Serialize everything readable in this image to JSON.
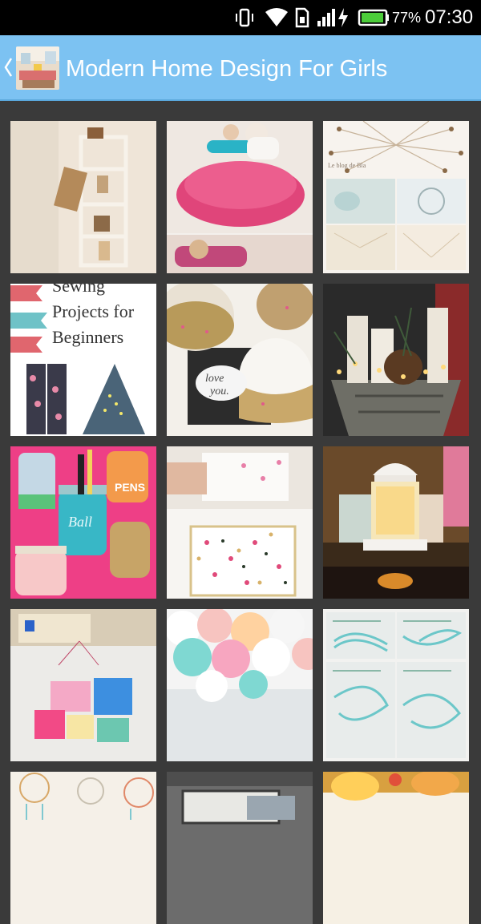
{
  "status_bar": {
    "battery_percent": "77%",
    "time": "07:30",
    "icons": [
      "vibrate-icon",
      "wifi-icon",
      "sim-icon",
      "signal-icon",
      "charging-icon",
      "battery-icon"
    ]
  },
  "app_bar": {
    "title": "Modern Home Design For Girls",
    "back_icon": "chevron-left-icon",
    "app_icon": "room-photo-icon"
  },
  "gallery": {
    "tiles": [
      {
        "name": "wall-shelves"
      },
      {
        "name": "floor-pillow"
      },
      {
        "name": "sunburst-diy",
        "caption": "Le blog de Bla"
      },
      {
        "name": "sewing-projects",
        "text": [
          "Sewing",
          "Projects for",
          "Beginners"
        ]
      },
      {
        "name": "glitter-balloons",
        "text": [
          "love",
          "you."
        ]
      },
      {
        "name": "birch-candles"
      },
      {
        "name": "mason-jars",
        "text": [
          "PENS",
          "Ball"
        ]
      },
      {
        "name": "confetti-art"
      },
      {
        "name": "lantern-house"
      },
      {
        "name": "wall-frames"
      },
      {
        "name": "pom-poms"
      },
      {
        "name": "knot-steps"
      },
      {
        "name": "dreamcatchers"
      },
      {
        "name": "photo-frame"
      },
      {
        "name": "glow-bottles"
      }
    ]
  },
  "colors": {
    "status_bar": "#000000",
    "app_bar": "#7cc2f2",
    "background": "#3a3a3a"
  }
}
